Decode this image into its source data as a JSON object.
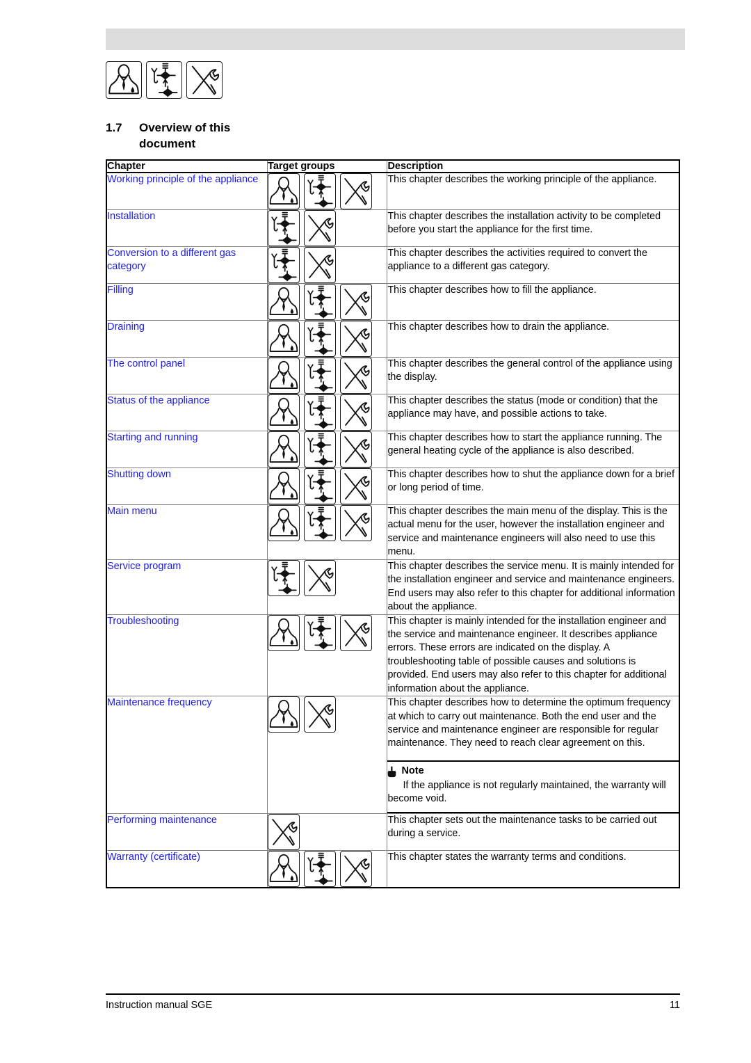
{
  "page": {
    "section_number": "1.7",
    "section_title_line1": "Overview of this",
    "section_title_line2": "document",
    "footer_left": "Instruction manual SGE",
    "footer_right": "11",
    "link_color": "#1a1ae6",
    "header_band_color": "#dcdcdc"
  },
  "target_group_icons": {
    "user": "user-bust-icon",
    "installer": "gas-valve-icon",
    "service": "crossed-tools-icon"
  },
  "header_icons": [
    "user-bust-icon",
    "gas-valve-icon",
    "crossed-tools-icon"
  ],
  "table": {
    "columns": [
      "Chapter",
      "Target groups",
      "Description"
    ],
    "rows": [
      {
        "chapter": "Working principle of the appliance",
        "icons": [
          "user",
          "installer",
          "service"
        ],
        "description": "This chapter describes the working principle of the appliance."
      },
      {
        "chapter": "Installation",
        "icons": [
          "installer",
          "service"
        ],
        "description": "This chapter describes the installation activity to be completed before you start the appliance for the first time."
      },
      {
        "chapter": "Conversion to a different gas category",
        "icons": [
          "installer",
          "service"
        ],
        "description": "This chapter describes the activities required to convert the appliance to a different gas category."
      },
      {
        "chapter": "Filling",
        "icons": [
          "user",
          "installer",
          "service"
        ],
        "description": "This chapter describes how to fill the appliance."
      },
      {
        "chapter": "Draining",
        "icons": [
          "user",
          "installer",
          "service"
        ],
        "description": "This chapter describes how to drain the appliance."
      },
      {
        "chapter": "The control panel",
        "icons": [
          "user",
          "installer",
          "service"
        ],
        "description": "This chapter describes the general control of the appliance using the display."
      },
      {
        "chapter": "Status of the appliance",
        "icons": [
          "user",
          "installer",
          "service"
        ],
        "description": "This chapter describes the status (mode or condition) that the appliance may have, and possible actions to take."
      },
      {
        "chapter": "Starting and running",
        "icons": [
          "user",
          "installer",
          "service"
        ],
        "description": "This chapter describes how to start the appliance running. The general heating cycle of the appliance is also described."
      },
      {
        "chapter": "Shutting down",
        "icons": [
          "user",
          "installer",
          "service"
        ],
        "description": "This chapter describes how to shut the appliance down for a brief or long period of time."
      },
      {
        "chapter": "Main menu",
        "icons": [
          "user",
          "installer",
          "service"
        ],
        "description": "This chapter describes the main menu of the display. This is the actual menu for the user, however the installation engineer and service and maintenance engineers will also need to use this menu."
      },
      {
        "chapter": "Service program",
        "icons": [
          "installer",
          "service"
        ],
        "description": "This chapter describes the service menu. It is mainly intended for the installation engineer and service and maintenance engineers. End users may also refer to this chapter for additional information about the appliance."
      },
      {
        "chapter": "Troubleshooting",
        "icons": [
          "user",
          "installer",
          "service"
        ],
        "description": "This chapter is mainly intended for the installation engineer and the service and maintenance engineer. It describes appliance errors. These errors are indicated on the display. A troubleshooting table of possible causes and solutions is provided. End users may also refer to this chapter for additional information about the appliance."
      },
      {
        "chapter": "Maintenance frequency",
        "icons": [
          "user",
          "service"
        ],
        "description": "This chapter describes how to determine the optimum frequency at which to carry out maintenance. Both the end user and the service and maintenance engineer are responsible for regular maintenance. They need to reach clear agreement on this.",
        "note": {
          "icon": "pointing-hand-icon",
          "title": "Note",
          "text": "If the appliance is not regularly maintained, the warranty will become void."
        }
      },
      {
        "chapter": "Performing maintenance",
        "icons": [
          "service"
        ],
        "description": "This chapter sets out the maintenance tasks to be carried out during a service."
      },
      {
        "chapter": "Warranty (certificate)",
        "icons": [
          "user",
          "installer",
          "service"
        ],
        "description": "This chapter states the warranty terms and conditions."
      }
    ]
  }
}
